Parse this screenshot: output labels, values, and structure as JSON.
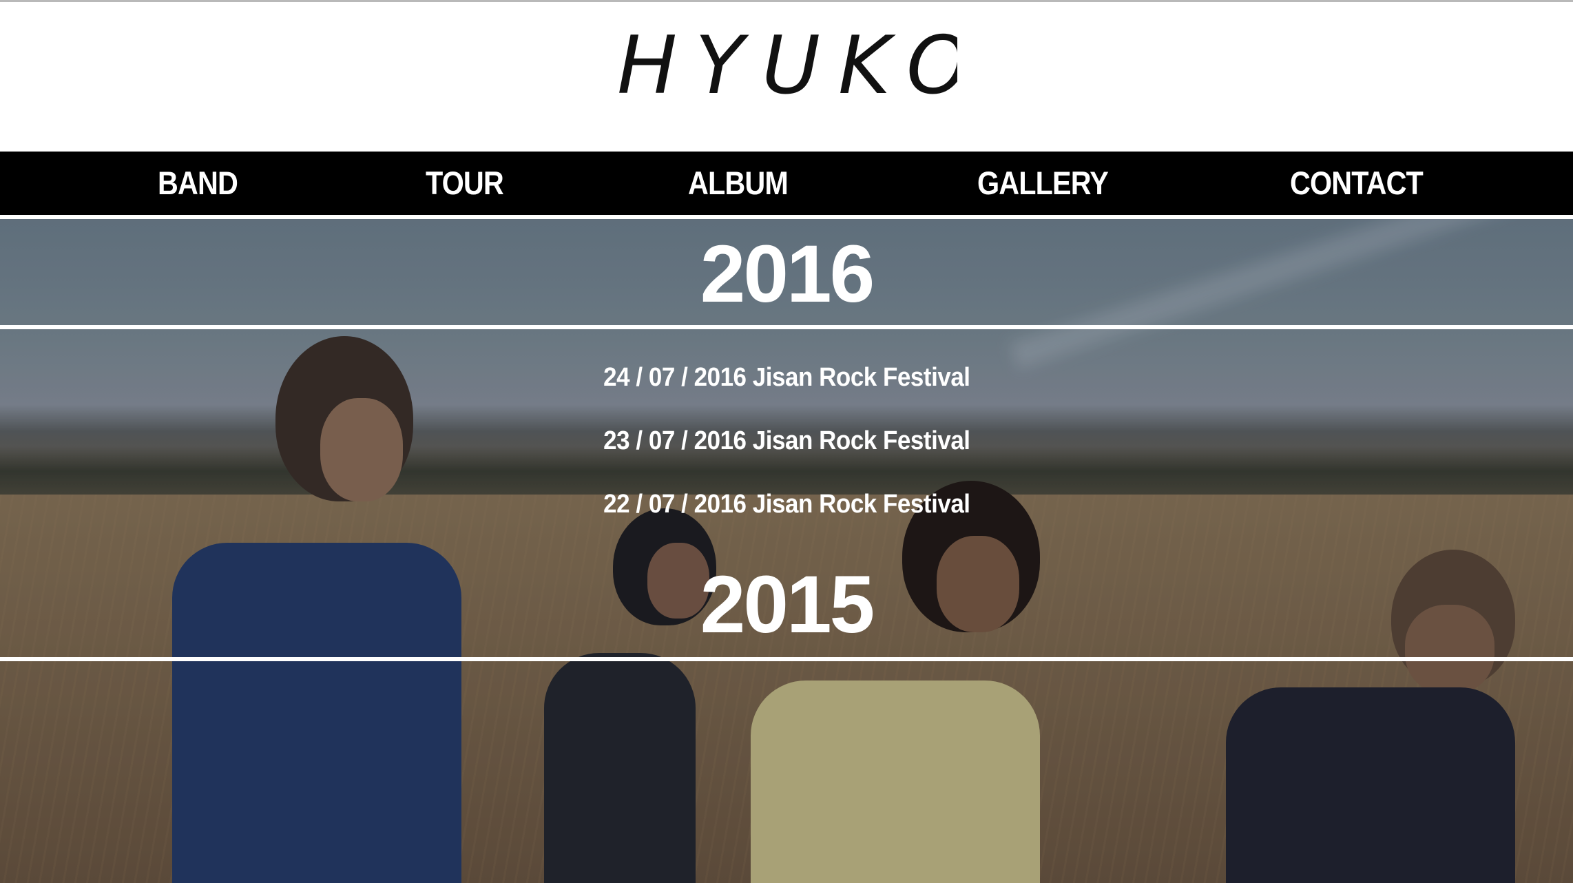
{
  "brand": {
    "logo_text": "HYUKOH"
  },
  "nav": {
    "items": [
      {
        "label": "BAND"
      },
      {
        "label": "TOUR"
      },
      {
        "label": "ALBUM"
      },
      {
        "label": "GALLERY"
      },
      {
        "label": "CONTACT"
      }
    ]
  },
  "tour": {
    "years": [
      {
        "year": "2016",
        "events": [
          {
            "text": "24 / 07 / 2016 Jisan Rock Festival"
          },
          {
            "text": "23 / 07 / 2016 Jisan Rock Festival"
          },
          {
            "text": "22 / 07 / 2016 Jisan Rock Festival"
          }
        ]
      },
      {
        "year": "2015",
        "events": []
      }
    ]
  },
  "colors": {
    "nav_background": "#000000",
    "nav_text": "#ffffff",
    "page_background": "#ffffff",
    "divider": "#ffffff"
  }
}
